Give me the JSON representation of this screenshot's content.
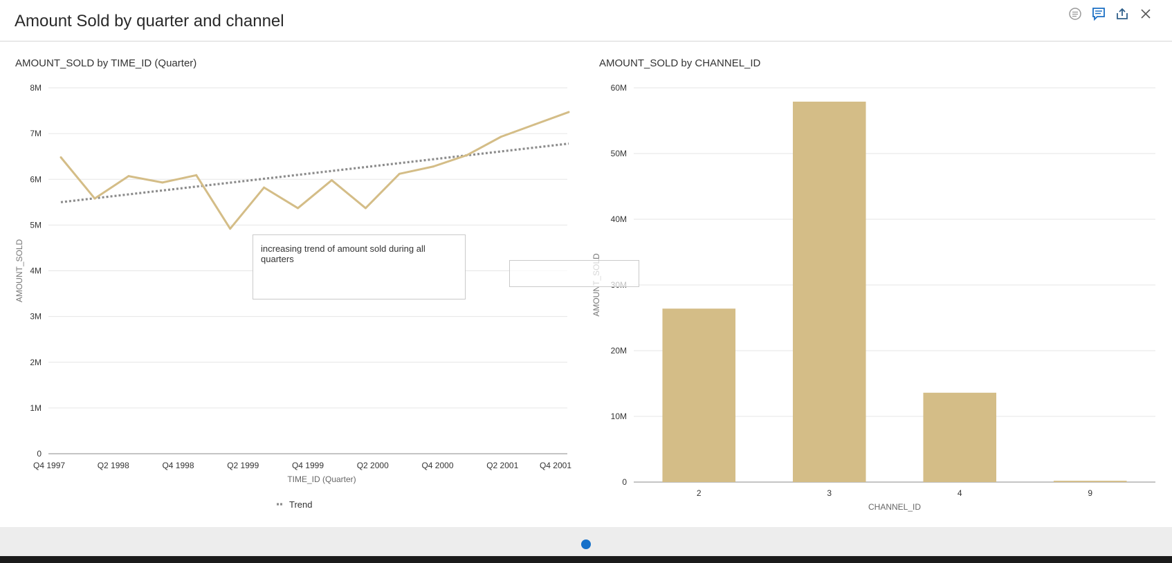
{
  "header": {
    "title": "Amount Sold by quarter and channel",
    "icons": [
      "annotations-toggle-icon",
      "comment-icon",
      "share-icon",
      "close-icon"
    ]
  },
  "annotation": {
    "text": "increasing trend of amount sold during all quarters"
  },
  "colors": {
    "series": "#d4bd87",
    "trend": "#8c8c8c",
    "grid": "#e6e6e6",
    "axis": "#888888",
    "page_indicator": "#1570c9"
  },
  "chart_data": [
    {
      "type": "line",
      "title": "AMOUNT_SOLD by TIME_ID (Quarter)",
      "xlabel": "TIME_ID (Quarter)",
      "ylabel": "AMOUNT_SOLD",
      "x": [
        "Q4 1997",
        "Q1 1998",
        "Q2 1998",
        "Q3 1998",
        "Q4 1998",
        "Q1 1999",
        "Q2 1999",
        "Q3 1999",
        "Q4 1999",
        "Q1 2000",
        "Q2 2000",
        "Q3 2000",
        "Q4 2000",
        "Q1 2001",
        "Q2 2001",
        "Q3 2001",
        "Q4 2001"
      ],
      "x_tick_labels": [
        "Q4 1997",
        "Q2 1998",
        "Q4 1998",
        "Q2 1999",
        "Q4 1999",
        "Q2 2000",
        "Q4 2000",
        "Q2 2001",
        "Q4 2001"
      ],
      "series": [
        {
          "values": [
            6.48,
            5.58,
            6.07,
            5.93,
            6.09,
            4.92,
            5.82,
            5.37,
            5.98,
            5.37,
            6.12,
            6.28,
            6.53,
            6.93,
            7.2,
            7.47
          ]
        }
      ],
      "trend": {
        "name": "Trend",
        "start": 5.5,
        "end": 6.78
      },
      "y_unit": "M",
      "ylim": [
        0,
        8
      ],
      "y_ticks": [
        "0",
        "1M",
        "2M",
        "3M",
        "4M",
        "5M",
        "6M",
        "7M",
        "8M"
      ],
      "grid": true,
      "legend": "bottom",
      "legend_entries": [
        "Trend"
      ]
    },
    {
      "type": "bar",
      "title": "AMOUNT_SOLD by CHANNEL_ID",
      "xlabel": "CHANNEL_ID",
      "ylabel": "AMOUNT_SOLD",
      "categories": [
        "2",
        "3",
        "4",
        "9"
      ],
      "values": [
        26.4,
        57.9,
        13.6,
        0.2
      ],
      "y_unit": "M",
      "ylim": [
        0,
        60
      ],
      "y_ticks": [
        "0",
        "10M",
        "20M",
        "30M",
        "40M",
        "50M",
        "60M"
      ],
      "grid": true
    }
  ]
}
